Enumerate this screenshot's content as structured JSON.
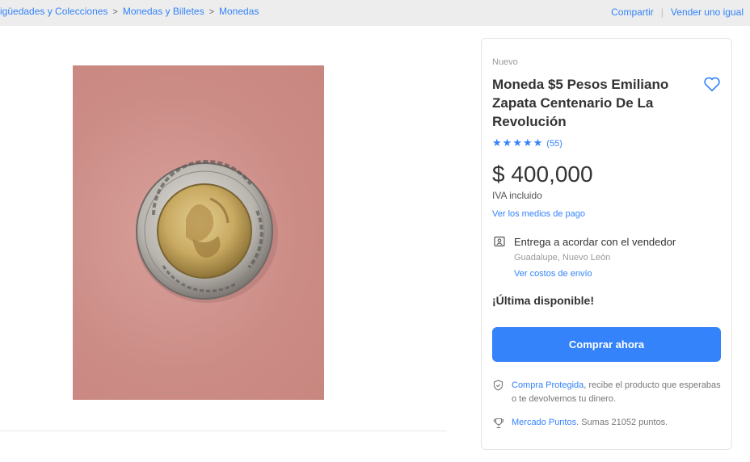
{
  "breadcrumb": {
    "items": [
      "igüedades y Colecciones",
      "Monedas y Billetes",
      "Monedas"
    ],
    "separator": ">"
  },
  "top_actions": {
    "share": "Compartir",
    "sell": "Vender uno igual"
  },
  "gallery": {
    "image_icon": "coin-photo"
  },
  "product": {
    "condition": "Nuevo",
    "title": "Moneda $5 Pesos Emiliano Zapata Centenario De La Revolución",
    "favorite_icon": "heart-icon",
    "rating": {
      "stars": 5,
      "star_glyph": "★",
      "count": "(55)"
    },
    "price": "$ 400,000",
    "tax_note": "IVA incluido",
    "payment_link": "Ver los medios de pago",
    "delivery": {
      "icon": "person-card-icon",
      "text": "Entrega a acordar con el vendedor",
      "location": "Guadalupe, Nuevo León",
      "shipping_link": "Ver costos de envío"
    },
    "stock": "¡Última disponible!",
    "buy_button": "Comprar ahora",
    "protection": {
      "icon": "shield-check-icon",
      "link": "Compra Protegida",
      "text": ", recibe el producto que esperabas o te devolvemos tu dinero."
    },
    "points": {
      "icon": "trophy-icon",
      "link": "Mercado Puntos",
      "text": ". Sumas 21052 puntos."
    }
  },
  "colors": {
    "accent": "#3483fa",
    "background": "#ededed",
    "photo_background": "#cf9089"
  }
}
